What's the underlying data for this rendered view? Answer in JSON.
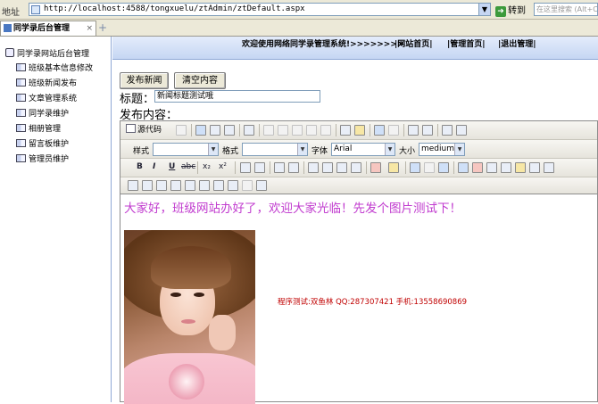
{
  "browser": {
    "address_label": "地址",
    "url": "http://localhost:4588/tongxuelu/ztAdmin/ztDefault.aspx",
    "go_label": "转到",
    "search_placeholder": "在这里搜索 (Alt+C)",
    "tab_title": "同学录后台管理",
    "tab_close": "×",
    "new_tab": "+"
  },
  "sidebar": {
    "root": "同学录网站后台管理",
    "items": [
      {
        "label": "班级基本信息修改"
      },
      {
        "label": "班级新闻发布"
      },
      {
        "label": "文章管理系统"
      },
      {
        "label": "同学录维护"
      },
      {
        "label": "相册管理"
      },
      {
        "label": "留言板维护"
      },
      {
        "label": "管理员维护"
      }
    ]
  },
  "header": {
    "welcome": "欢迎使用网络同学录管理系统!>>>>>>>>",
    "links": [
      {
        "label": "|网站首页|"
      },
      {
        "label": "|管理首页|"
      },
      {
        "label": "|退出管理|"
      }
    ]
  },
  "form": {
    "publish_button": "发布新闻",
    "clear_button": "清空内容",
    "title_label": "标题：",
    "title_value": "新闻标题测试哦",
    "content_label": "发布内容："
  },
  "editor": {
    "source_label": "源代码",
    "style_label": "样式",
    "format_label": "格式",
    "font_label": "字体",
    "font_value": "Arial",
    "size_label": "大小",
    "size_value": "medium",
    "bold": "B",
    "italic": "I",
    "underline": "U",
    "strike": "abc",
    "subscript": "x₂",
    "superscript": "x²",
    "body_text": "大家好，班级网站办好了，欢迎大家光临！先发个图片测试下！",
    "credit_text": "程序测试:双鱼林  QQ:287307421  手机:13558690869"
  },
  "colors": {
    "pink_text": "#c13ccf",
    "red_text": "#c00000",
    "header_bg": "#c5d6f3"
  }
}
